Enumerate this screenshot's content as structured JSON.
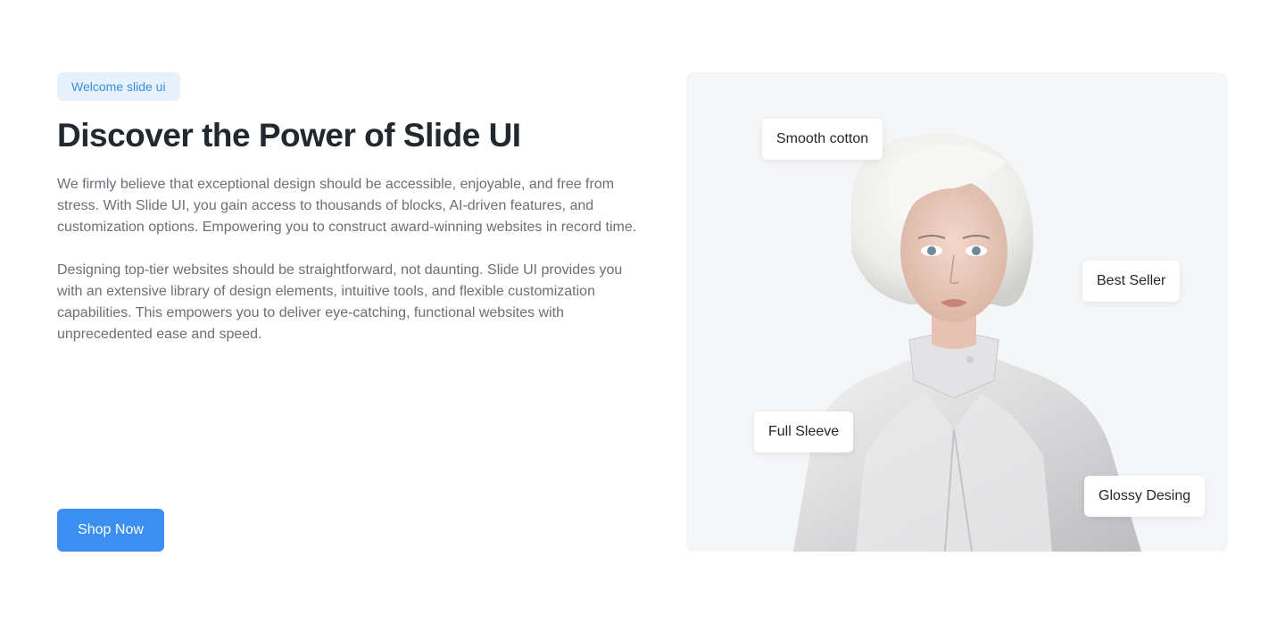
{
  "hero": {
    "badge": "Welcome slide ui",
    "title": "Discover the Power of Slide UI",
    "paragraph_1": " We firmly believe that exceptional design should be accessible, enjoyable, and free from stress. With Slide UI, you gain access to thousands of blocks, AI-driven features, and customization options. Empowering you to construct award-winning websites in record time.",
    "paragraph_2": "Designing top-tier websites should be straightforward, not daunting. Slide UI provides you with an extensive library of design elements, intuitive tools, and flexible customization capabilities. This empowers you to deliver eye-catching, functional websites with unprecedented ease and speed.",
    "cta_label": "Shop Now"
  },
  "showcase": {
    "tags": [
      "Smooth cotton",
      "Best Seller",
      "Full Sleeve",
      "Glossy Desing"
    ]
  },
  "colors": {
    "accent": "#3b8ff0",
    "badge_bg": "#e6f1fc",
    "panel_bg": "#f5f6f8"
  }
}
